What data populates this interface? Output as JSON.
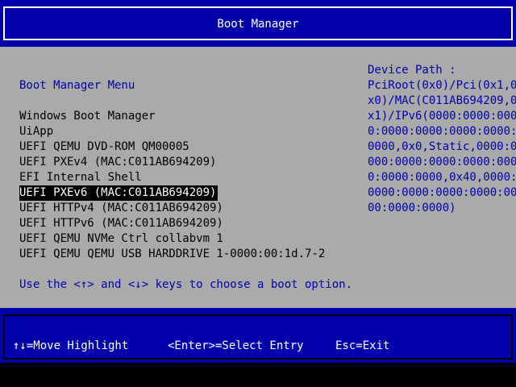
{
  "colors": {
    "header_bg": "#0000aa",
    "panel_bg": "#aaaaaa",
    "accent_text": "#0000aa",
    "selection_bg": "#000000",
    "selection_fg": "#ffffff"
  },
  "header": {
    "title": "Boot Manager"
  },
  "menu": {
    "title": "Boot Manager Menu",
    "items": [
      {
        "label": "Windows Boot Manager"
      },
      {
        "label": "UiApp"
      },
      {
        "label": "UEFI QEMU DVD-ROM QM00005"
      },
      {
        "label": "UEFI PXEv4 (MAC:C011AB694209)"
      },
      {
        "label": "EFI Internal Shell"
      },
      {
        "label": "UEFI PXEv6 (MAC:C011AB694209)",
        "selected": true
      },
      {
        "label": "UEFI HTTPv4 (MAC:C011AB694209)"
      },
      {
        "label": "UEFI HTTPv6 (MAC:C011AB694209)"
      },
      {
        "label": "UEFI QEMU NVMe Ctrl collabvm 1"
      },
      {
        "label": "UEFI QEMU QEMU USB HARDDRIVE 1-0000:00:1d.7-2"
      }
    ],
    "hint": "Use the <↑> and <↓> keys to choose a boot option."
  },
  "device_path": {
    "label": "Device Path :",
    "lines": [
      "PciRoot(0x0)/Pci(0x1,0",
      "x0)/MAC(C011AB694209,0",
      "x1)/IPv6(0000:0000:000",
      "0:0000:0000:0000:0000:",
      "0000,0x0,Static,0000:0",
      "000:0000:0000:0000:000",
      "0:0000:0000,0x40,0000:",
      "0000:0000:0000:0000:00",
      "00:0000:0000)"
    ]
  },
  "footer": {
    "move": "↑↓=Move Highlight",
    "enter": "<Enter>=Select Entry",
    "esc": "Esc=Exit"
  }
}
